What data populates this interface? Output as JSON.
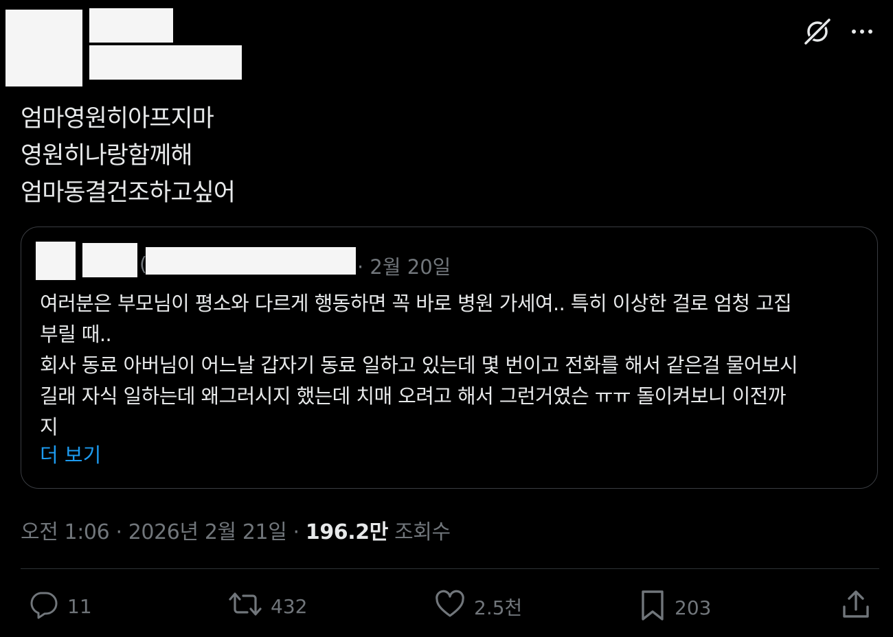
{
  "header": {
    "grok_icon": "grok-icon",
    "more_icon": "more-icon"
  },
  "tweet": {
    "lines": [
      "엄마영원히아프지마",
      "영원히나랑함께해",
      "엄마동결건조하고싶어"
    ]
  },
  "quote": {
    "at_fragment": "(",
    "date": "· 2월 20일",
    "lines": [
      "여러분은 부모님이 평소와 다르게 행동하면 꼭 바로 병원 가세여.. 특히 이상한 걸로 엄청 고집",
      "부릴 때..",
      "회사 동료 아버님이 어느날 갑자기 동료 일하고 있는데 몇 번이고 전화를 해서 같은걸 물어보시",
      "길래 자식 일하는데 왜그러시지 했는데 치매 오려고 해서 그런거였슨 ㅠㅠ 돌이켜보니 이전까",
      "지"
    ],
    "show_more": "더 보기"
  },
  "meta": {
    "time": "오전 1:06",
    "sep1": " · ",
    "date": "2026년 2월 21일",
    "sep2": " · ",
    "views_count": "196.2만",
    "views_label": " 조회수"
  },
  "actions": {
    "replies": "11",
    "retweets": "432",
    "likes": "2.5천",
    "bookmarks": "203"
  },
  "colors": {
    "background": "#000000",
    "text": "#e7e9ea",
    "muted": "#71767b",
    "link": "#1d9bf0",
    "border": "#2f3336"
  }
}
